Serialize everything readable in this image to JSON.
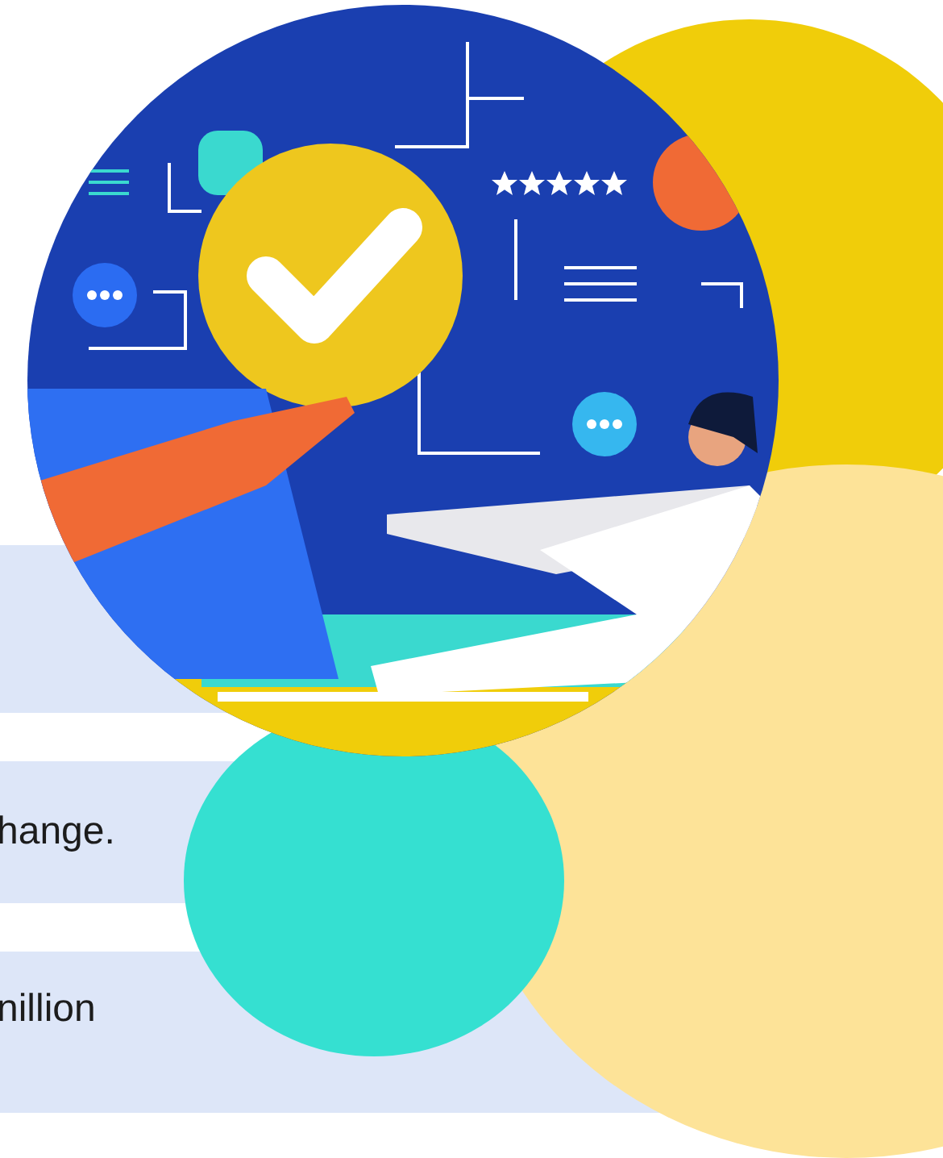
{
  "bands": [
    {
      "kind": "blank"
    },
    {
      "kind": "text",
      "text": "hange."
    },
    {
      "kind": "text",
      "text": "nillion"
    }
  ]
}
